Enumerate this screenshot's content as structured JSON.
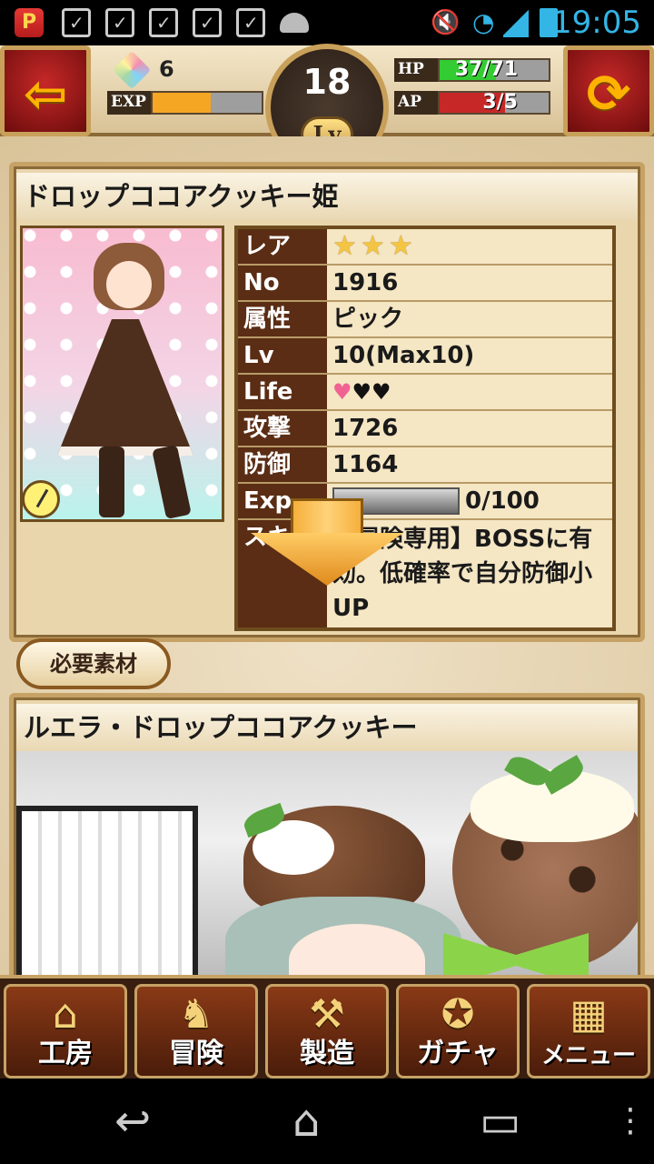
{
  "status_bar": {
    "time": "19:05",
    "app_icon_letter": "P"
  },
  "header": {
    "gem_count": "6",
    "exp_label": "EXP",
    "exp_progress": 0.53,
    "level": "18",
    "level_tag": "Lv",
    "hp_label": "HP",
    "hp_value": "37/71",
    "hp_progress": 0.52,
    "ap_label": "AP",
    "ap_value": "3/5",
    "ap_progress": 0.6,
    "back_icon": "back-arrow-icon",
    "refresh_icon": "refresh-icon"
  },
  "card": {
    "name": "ドロップココアクッキー姫",
    "stats": [
      {
        "key": "レア",
        "value": ""
      },
      {
        "key": "No",
        "value": "1916"
      },
      {
        "key": "属性",
        "value": "ピック"
      },
      {
        "key": "Lv",
        "value": "10(Max10)"
      },
      {
        "key": "Life",
        "value": ""
      },
      {
        "key": "攻撃",
        "value": "1726"
      },
      {
        "key": "防御",
        "value": "1164"
      },
      {
        "key": "Exp",
        "value": "0/100"
      },
      {
        "key": "スキル",
        "value": "【冒険専用】BOSSに有効。低確率で自分防御小UP"
      }
    ],
    "rarity_stars": 3,
    "life_hearts": {
      "pink": 1,
      "black": 2
    }
  },
  "evolved": {
    "name": "ルエラ・ドロップココアクッキー",
    "needs_button": "必要素材"
  },
  "bottom_nav": [
    {
      "label": "工房",
      "icon": "house-icon"
    },
    {
      "label": "冒険",
      "icon": "shoes-icon"
    },
    {
      "label": "製造",
      "icon": "rolling-pin-icon"
    },
    {
      "label": "ガチャ",
      "icon": "medal-icon"
    },
    {
      "label": "メニュー",
      "icon": "grid-menu-icon"
    }
  ],
  "colors": {
    "hp_fill": "#33cc33",
    "ap_fill": "#c62828",
    "exp_fill": "#f5a623",
    "panel": "#e9d6ad",
    "key_bg": "#5a2d14"
  }
}
